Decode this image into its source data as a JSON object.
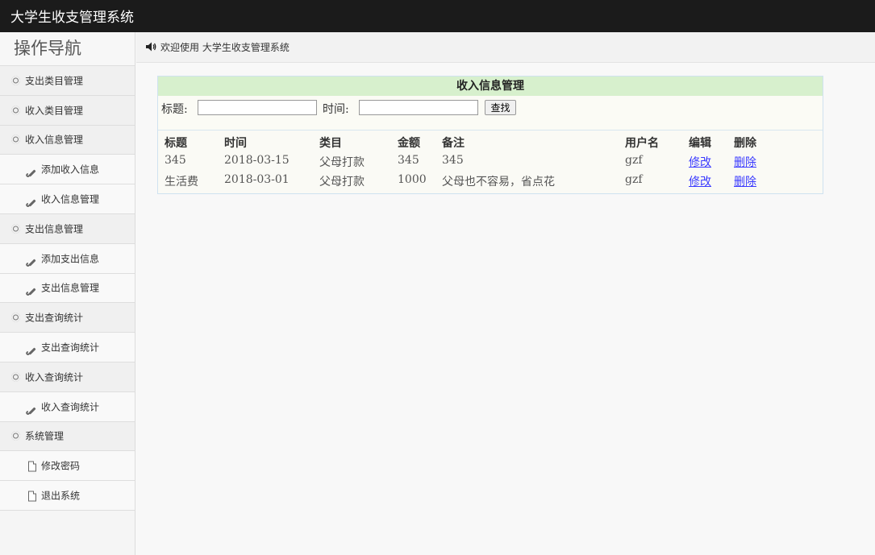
{
  "app": {
    "title": "大学生收支管理系统"
  },
  "sidebar": {
    "heading": "操作导航",
    "items": [
      {
        "label": "支出类目管理",
        "icon": "gear-icon",
        "level": "top"
      },
      {
        "label": "收入类目管理",
        "icon": "gear-icon",
        "level": "top"
      },
      {
        "label": "收入信息管理",
        "icon": "gear-icon",
        "level": "top"
      },
      {
        "label": "添加收入信息",
        "icon": "wrench-icon",
        "level": "sub"
      },
      {
        "label": "收入信息管理",
        "icon": "wrench-icon",
        "level": "sub"
      },
      {
        "label": "支出信息管理",
        "icon": "gear-icon",
        "level": "top"
      },
      {
        "label": "添加支出信息",
        "icon": "wrench-icon",
        "level": "sub"
      },
      {
        "label": "支出信息管理",
        "icon": "wrench-icon",
        "level": "sub"
      },
      {
        "label": "支出查询统计",
        "icon": "gear-icon",
        "level": "top"
      },
      {
        "label": "支出查询统计",
        "icon": "wrench-icon",
        "level": "sub"
      },
      {
        "label": "收入查询统计",
        "icon": "gear-icon",
        "level": "top"
      },
      {
        "label": "收入查询统计",
        "icon": "wrench-icon",
        "level": "sub"
      },
      {
        "label": "系统管理",
        "icon": "gear-icon",
        "level": "top"
      },
      {
        "label": "修改密码",
        "icon": "document-icon",
        "level": "sub"
      },
      {
        "label": "退出系统",
        "icon": "document-icon",
        "level": "sub"
      }
    ]
  },
  "breadcrumb": {
    "icon": "speaker-icon",
    "text": "欢迎使用 大学生收支管理系统"
  },
  "panel": {
    "title": "收入信息管理",
    "search": {
      "title_label": "标题:",
      "title_value": "",
      "time_label": "时间:",
      "time_value": "",
      "button": "查找"
    },
    "table": {
      "headers": [
        "标题",
        "时间",
        "类目",
        "金额",
        "备注",
        "用户名",
        "编辑",
        "删除"
      ],
      "rows": [
        {
          "title": "345",
          "time": "2018-03-15",
          "category": "父母打款",
          "amount": "345",
          "note": "345",
          "user": "gzf",
          "edit": "修改",
          "delete": "删除"
        },
        {
          "title": "生活费",
          "time": "2018-03-01",
          "category": "父母打款",
          "amount": "1000",
          "note": "父母也不容易，省点花",
          "user": "gzf",
          "edit": "修改",
          "delete": "删除"
        }
      ]
    }
  }
}
